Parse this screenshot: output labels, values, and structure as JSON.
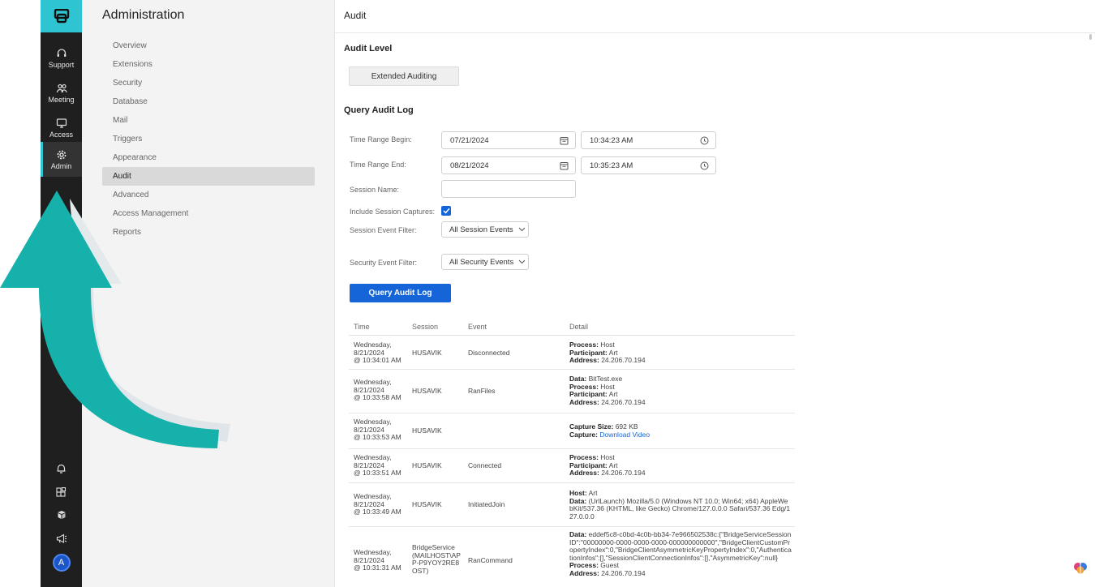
{
  "rail": {
    "items": [
      {
        "label": "Support",
        "icon": "headset-icon"
      },
      {
        "label": "Meeting",
        "icon": "people-icon"
      },
      {
        "label": "Access",
        "icon": "monitor-icon"
      },
      {
        "label": "Admin",
        "icon": "gear-icon"
      }
    ],
    "bottom": [
      {
        "icon": "bell-icon"
      },
      {
        "icon": "apps-icon"
      },
      {
        "icon": "cube-icon"
      },
      {
        "icon": "megaphone-icon"
      }
    ],
    "avatar": "A",
    "accent": "#2fc4d2"
  },
  "nav": {
    "title": "Administration",
    "items": [
      "Overview",
      "Extensions",
      "Security",
      "Database",
      "Mail",
      "Triggers",
      "Appearance",
      "Audit",
      "Advanced",
      "Access Management",
      "Reports"
    ],
    "active": "Audit"
  },
  "main": {
    "header": "Audit",
    "audit_level_title": "Audit Level",
    "audit_level_button": "Extended Auditing",
    "query_title": "Query Audit Log",
    "labels": {
      "begin": "Time Range Begin:",
      "end": "Time Range End:",
      "session_name": "Session Name:",
      "include_captures": "Include Session Captures:",
      "session_filter": "Session Event Filter:",
      "security_filter": "Security Event Filter:"
    },
    "begin_date": "07/21/2024",
    "begin_time": "10:34:23 AM",
    "end_date": "08/21/2024",
    "end_time": "10:35:23 AM",
    "session_name_value": "",
    "include_captures_checked": true,
    "session_filter_value": "All Session Events",
    "security_filter_value": "All Security Events",
    "query_button": "Query Audit Log",
    "primary_color": "#1565d8"
  },
  "table": {
    "headers": [
      "Time",
      "Session",
      "Event",
      "Detail"
    ],
    "rows": [
      {
        "time": [
          "Wednesday,",
          "8/21/2024",
          "@ 10:34:01 AM"
        ],
        "session": "HUSAVIK",
        "event": "Disconnected",
        "detail": [
          [
            "Process:",
            " Host"
          ],
          [
            "Participant:",
            " Art"
          ],
          [
            "Address:",
            " 24.206.70.194"
          ]
        ]
      },
      {
        "time": [
          "Wednesday,",
          "8/21/2024",
          "@ 10:33:58 AM"
        ],
        "session": "HUSAVIK",
        "event": "RanFiles",
        "detail": [
          [
            "Data:",
            " BitTest.exe"
          ],
          [
            "Process:",
            " Host"
          ],
          [
            "Participant:",
            " Art"
          ],
          [
            "Address:",
            " 24.206.70.194"
          ]
        ]
      },
      {
        "time": [
          "Wednesday,",
          "8/21/2024",
          "@ 10:33:53 AM"
        ],
        "session": "HUSAVIK",
        "event": "",
        "detail": [
          [
            "Capture Size:",
            " 692 KB"
          ],
          [
            "Capture:",
            " "
          ]
        ],
        "link": "Download Video"
      },
      {
        "time": [
          "Wednesday,",
          "8/21/2024",
          "@ 10:33:51 AM"
        ],
        "session": "HUSAVIK",
        "event": "Connected",
        "detail": [
          [
            "Process:",
            " Host"
          ],
          [
            "Participant:",
            " Art"
          ],
          [
            "Address:",
            " 24.206.70.194"
          ]
        ]
      },
      {
        "time": [
          "Wednesday,",
          "8/21/2024",
          "@ 10:33:49 AM"
        ],
        "session": "HUSAVIK",
        "event": "InitiatedJoin",
        "detail": [
          [
            "Host:",
            " Art"
          ],
          [
            "Data:",
            " (UrlLaunch) Mozilla/5.0 (Windows NT 10.0; Win64; x64) AppleWebKit/537.36 (KHTML, like Gecko) Chrome/127.0.0.0 Safari/537.36 Edg/127.0.0.0"
          ]
        ]
      },
      {
        "time": [
          "Wednesday,",
          "8/21/2024",
          "@ 10:31:31 AM"
        ],
        "session": "BridgeService (MAILHOST\\APP-P9YOY2RE8OST)",
        "event": "RanCommand",
        "detail": [
          [
            "Data:",
            " eddef5c8-c0bd-4c0b-bb34-7e966502538c:{\"BridgeServiceSessionID\":\"00000000-0000-0000-0000-000000000000\",\"BridgeClientCustomPropertyIndex\":0,\"BridgeClientAsymmetricKeyPropertyIndex\":0,\"AuthenticationInfos\":[],\"SessionClientConnectionInfos\":[],\"AsymmetricKey\":null}"
          ],
          [
            "Process:",
            " Guest"
          ],
          [
            "Address:",
            " 24.206.70.194"
          ]
        ]
      }
    ]
  }
}
